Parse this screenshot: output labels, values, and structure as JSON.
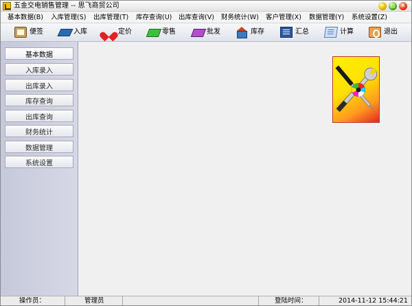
{
  "window": {
    "title": "五金交电销售管理 -- 思飞商贸公司"
  },
  "menu": [
    {
      "label": "基本数据(B)"
    },
    {
      "label": "入库管理(S)"
    },
    {
      "label": "出库管理(T)"
    },
    {
      "label": "库存查询(U)"
    },
    {
      "label": "出库查询(V)"
    },
    {
      "label": "财务统计(W)"
    },
    {
      "label": "客户管理(X)"
    },
    {
      "label": "数据管理(Y)"
    },
    {
      "label": "系统设置(Z)"
    }
  ],
  "toolbar": [
    {
      "label": "便签",
      "icon": "note-icon"
    },
    {
      "label": "入库",
      "icon": "inbound-icon"
    },
    {
      "label": "定价",
      "icon": "pricing-icon"
    },
    {
      "label": "零售",
      "icon": "retail-icon"
    },
    {
      "label": "批发",
      "icon": "wholesale-icon"
    },
    {
      "label": "库存",
      "icon": "inventory-icon"
    },
    {
      "label": "汇总",
      "icon": "summary-icon"
    },
    {
      "label": "计算",
      "icon": "calculator-icon"
    },
    {
      "label": "退出",
      "icon": "exit-icon"
    }
  ],
  "sidebar": [
    {
      "label": "基本数据"
    },
    {
      "label": "入库录入"
    },
    {
      "label": "出库录入"
    },
    {
      "label": "库存查询"
    },
    {
      "label": "出库查询"
    },
    {
      "label": "财务统计"
    },
    {
      "label": "数据管理"
    },
    {
      "label": "系统设置"
    }
  ],
  "status": {
    "operator_label": "操作员：",
    "operator_value": "管理员",
    "login_label": "登陆时间：",
    "login_value": "2014-11-12 15:44:21"
  },
  "logo": {
    "icon": "tools-logo-icon",
    "colors": [
      "#fff000",
      "#ff9a20",
      "#e02a20"
    ]
  }
}
